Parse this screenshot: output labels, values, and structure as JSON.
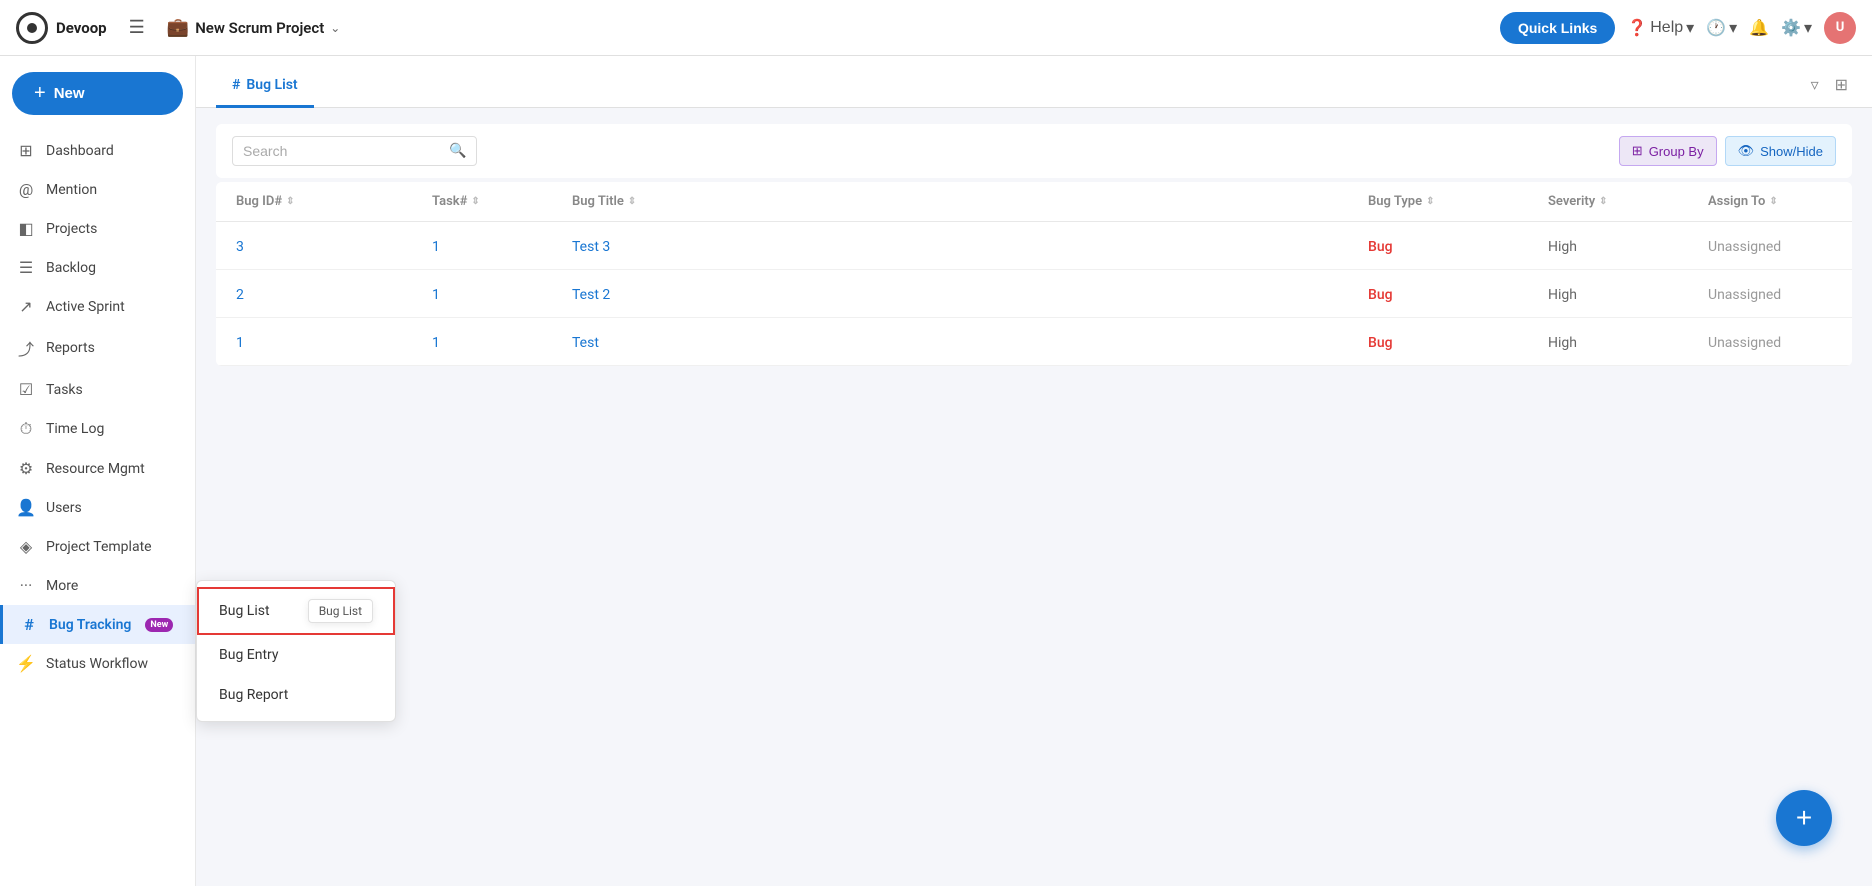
{
  "topbar": {
    "logo_text": "Devoop",
    "project_name": "New Scrum Project",
    "quick_links_label": "Quick Links",
    "help_label": "Help",
    "avatar_initials": "U"
  },
  "new_button": {
    "label": "New"
  },
  "sidebar": {
    "items": [
      {
        "id": "dashboard",
        "label": "Dashboard",
        "icon": "⊞"
      },
      {
        "id": "mention",
        "label": "Mention",
        "icon": "＠"
      },
      {
        "id": "projects",
        "label": "Projects",
        "icon": "◧"
      },
      {
        "id": "backlog",
        "label": "Backlog",
        "icon": "☰"
      },
      {
        "id": "active-sprint",
        "label": "Active Sprint",
        "icon": "↗"
      },
      {
        "id": "reports",
        "label": "Reports",
        "icon": "⤴"
      },
      {
        "id": "tasks",
        "label": "Tasks",
        "icon": "☑"
      },
      {
        "id": "time-log",
        "label": "Time Log",
        "icon": "⏱"
      },
      {
        "id": "resource-mgmt",
        "label": "Resource Mgmt",
        "icon": "⚙"
      },
      {
        "id": "users",
        "label": "Users",
        "icon": "👤"
      },
      {
        "id": "project-template",
        "label": "Project Template",
        "icon": "◈"
      },
      {
        "id": "more",
        "label": "More",
        "icon": "⋯"
      },
      {
        "id": "bug-tracking",
        "label": "Bug Tracking",
        "icon": "#",
        "badge": "New"
      },
      {
        "id": "status-workflow",
        "label": "Status Workflow",
        "icon": "⚡"
      }
    ]
  },
  "tab": {
    "label": "Bug List",
    "icon": "#"
  },
  "toolbar": {
    "search_placeholder": "Search",
    "group_by_label": "Group By",
    "show_hide_label": "Show/Hide"
  },
  "table": {
    "columns": [
      {
        "id": "bug-id",
        "label": "Bug ID#"
      },
      {
        "id": "task",
        "label": "Task#"
      },
      {
        "id": "title",
        "label": "Bug Title"
      },
      {
        "id": "type",
        "label": "Bug Type"
      },
      {
        "id": "severity",
        "label": "Severity"
      },
      {
        "id": "assign",
        "label": "Assign To"
      }
    ],
    "rows": [
      {
        "bug_id": "3",
        "task": "1",
        "title": "Test 3",
        "type": "Bug",
        "severity": "High",
        "assign": "Unassigned"
      },
      {
        "bug_id": "2",
        "task": "1",
        "title": "Test 2",
        "type": "Bug",
        "severity": "High",
        "assign": "Unassigned"
      },
      {
        "bug_id": "1",
        "task": "1",
        "title": "Test",
        "type": "Bug",
        "severity": "High",
        "assign": "Unassigned"
      }
    ]
  },
  "dropdown": {
    "items": [
      {
        "id": "bug-list",
        "label": "Bug List",
        "selected": true
      },
      {
        "id": "bug-entry",
        "label": "Bug Entry",
        "selected": false
      },
      {
        "id": "bug-report",
        "label": "Bug Report",
        "selected": false
      }
    ],
    "tooltip": "Bug List"
  },
  "fab": {
    "label": "+"
  }
}
